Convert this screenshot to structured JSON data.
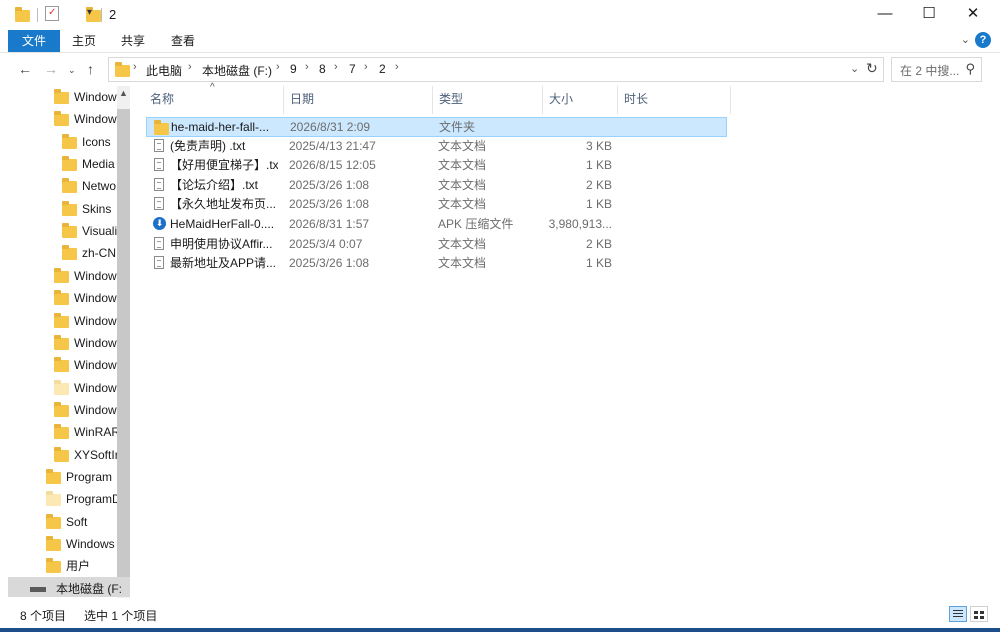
{
  "window": {
    "title": "2"
  },
  "window_controls": {
    "minimize": "—",
    "maximize": "☐",
    "close": "✕"
  },
  "ribbon": {
    "tabs": [
      "文件",
      "主页",
      "共享",
      "查看"
    ],
    "help": "?"
  },
  "address": {
    "crumbs": [
      "此电脑",
      "本地磁盘 (F:)",
      "9",
      "8",
      "7",
      "2"
    ],
    "search_placeholder": "在 2 中搜..."
  },
  "nav_tree": [
    {
      "label": "Window",
      "level": 1
    },
    {
      "label": "Window",
      "level": 1
    },
    {
      "label": "Icons",
      "level": 2
    },
    {
      "label": "Media",
      "level": 2
    },
    {
      "label": "Netwo",
      "level": 2
    },
    {
      "label": "Skins",
      "level": 2
    },
    {
      "label": "Visuali",
      "level": 2
    },
    {
      "label": "zh-CN",
      "level": 2
    },
    {
      "label": "Window",
      "level": 1
    },
    {
      "label": "Window",
      "level": 1
    },
    {
      "label": "Window",
      "level": 1
    },
    {
      "label": "Window",
      "level": 1
    },
    {
      "label": "Window",
      "level": 1
    },
    {
      "label": "Window",
      "level": 1,
      "pale": true
    },
    {
      "label": "Window",
      "level": 1
    },
    {
      "label": "WinRAR",
      "level": 1
    },
    {
      "label": "XYSoftIr",
      "level": 1
    },
    {
      "label": "Program",
      "level": 0
    },
    {
      "label": "ProgramD",
      "level": 0,
      "pale": true
    },
    {
      "label": "Soft",
      "level": 0
    },
    {
      "label": "Windows",
      "level": 0
    },
    {
      "label": "用户",
      "level": 0
    }
  ],
  "drive": {
    "label": "本地磁盘 (F:"
  },
  "columns": [
    "名称",
    "日期",
    "类型",
    "大小",
    "时长"
  ],
  "files": [
    {
      "name": "he-maid-her-fall-...",
      "date": "2026/8/31 2:09",
      "type": "文件夹",
      "size": "",
      "icon": "folder-icon",
      "selected": true
    },
    {
      "name": "(免责声明) .txt",
      "date": "2025/4/13 21:47",
      "type": "文本文档",
      "size": "3 KB",
      "icon": "text-file-icon"
    },
    {
      "name": "【好用便宜梯子】.txt",
      "date": "2026/8/15 12:05",
      "type": "文本文档",
      "size": "1 KB",
      "icon": "text-file-icon"
    },
    {
      "name": "【论坛介绍】.txt",
      "date": "2025/3/26 1:08",
      "type": "文本文档",
      "size": "2 KB",
      "icon": "text-file-icon"
    },
    {
      "name": "【永久地址发布页...",
      "date": "2025/3/26 1:08",
      "type": "文本文档",
      "size": "1 KB",
      "icon": "text-file-icon"
    },
    {
      "name": "HeMaidHerFall-0....",
      "date": "2026/8/31 1:57",
      "type": "APK 压缩文件",
      "size": "3,980,913...",
      "icon": "apk-file-icon"
    },
    {
      "name": "申明使用协议Affir...",
      "date": "2025/3/4 0:07",
      "type": "文本文档",
      "size": "2 KB",
      "icon": "text-file-icon"
    },
    {
      "name": "最新地址及APP请...",
      "date": "2025/3/26 1:08",
      "type": "文本文档",
      "size": "1 KB",
      "icon": "text-file-icon"
    }
  ],
  "status": {
    "count": "8 个项目",
    "selected": "选中 1 个项目"
  },
  "colors": {
    "accent": "#1979ca",
    "selection": "#cce8ff",
    "folder": "#f6c648"
  }
}
